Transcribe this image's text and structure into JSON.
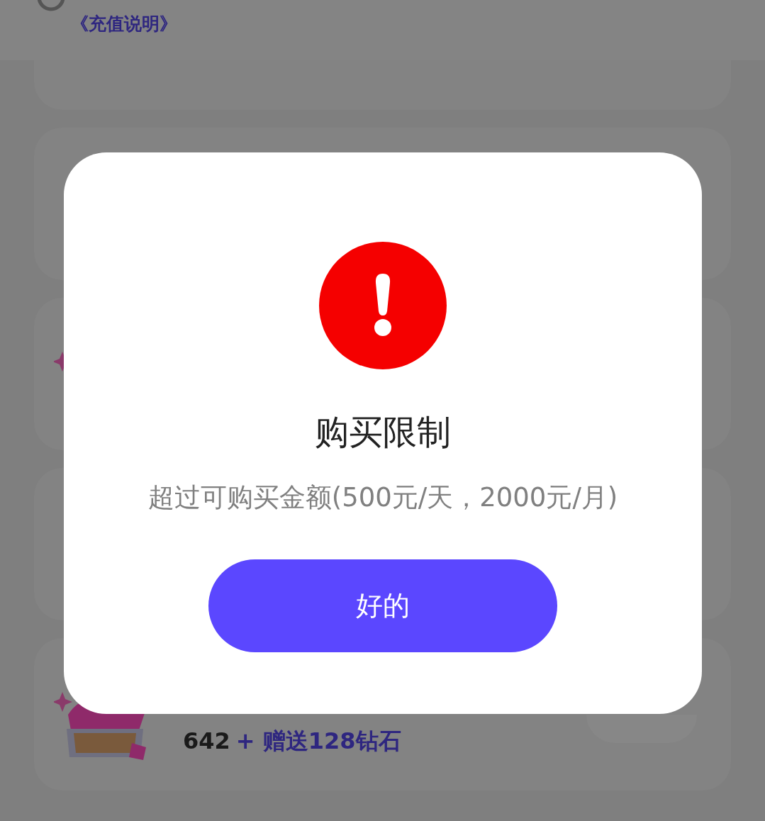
{
  "notice": {
    "link": "《充值说明》"
  },
  "packages": [
    {
      "kind": "cut"
    },
    {
      "kind": "plain"
    },
    {
      "kind": "chest"
    },
    {
      "kind": "plain"
    },
    {
      "amount": "642",
      "bonus": "+ 赠送128钻石",
      "kind": "chest_with_price"
    }
  ],
  "dialog": {
    "title": "购买限制",
    "message": "超过可购买金额(500元/天，2000元/月)",
    "button": "好的"
  }
}
